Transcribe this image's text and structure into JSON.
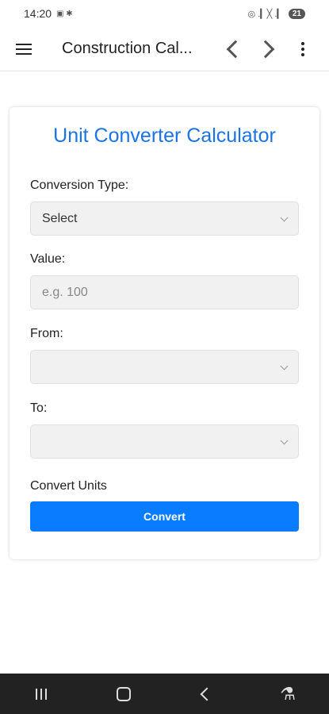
{
  "status_bar": {
    "time": "14:20",
    "left_icons": "▣ ✱",
    "right_icons": "◎ .▎╳ .▎",
    "battery": "21"
  },
  "app_bar": {
    "title": "Construction Cal...",
    "menu_icon": "menu-icon",
    "back_icon": "chevron-left-icon",
    "forward_icon": "chevron-right-icon",
    "more_icon": "more-vert-icon"
  },
  "calculator": {
    "title": "Unit Converter Calculator",
    "conversion_type": {
      "label": "Conversion Type:",
      "selected": "Select"
    },
    "value": {
      "label": "Value:",
      "placeholder": "e.g. 100"
    },
    "from": {
      "label": "From:",
      "selected": ""
    },
    "to": {
      "label": "To:",
      "selected": ""
    },
    "convert_section_label": "Convert Units",
    "convert_button": "Convert"
  },
  "colors": {
    "accent": "#1a73e8",
    "button": "#0a7cff",
    "nav_bar": "#222222"
  },
  "system_nav": {
    "recents_icon": "recents-icon",
    "home_icon": "home-icon",
    "back_icon": "back-icon",
    "accessibility_icon": "accessibility-icon"
  }
}
